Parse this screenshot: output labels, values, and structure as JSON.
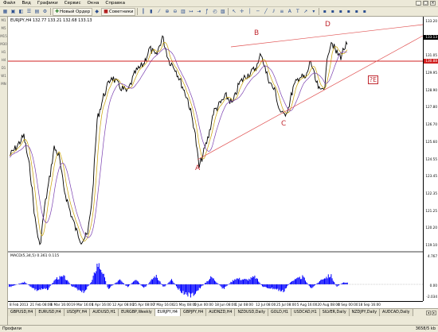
{
  "menu": [
    "Файл",
    "Вид",
    "Графики",
    "Сервис",
    "Окна",
    "Справка"
  ],
  "toolbar": {
    "new_order": "Новый Ордер",
    "advisors": "Советники"
  },
  "sidebar_items": [
    "M1",
    "M5",
    "M15",
    "M30",
    "H1",
    "H4",
    "D1",
    "W1",
    "MN"
  ],
  "chart": {
    "title": "EURJPY,H4  132.77 133.21 132.68 133.13",
    "price_labels": [
      "133.20",
      "132.10",
      "131.05",
      "129.95",
      "128.90",
      "127.80",
      "126.70",
      "125.60",
      "124.55",
      "123.45",
      "122.35",
      "121.25",
      "120.20",
      "119.10"
    ],
    "current_price": "133.13",
    "line_price": "130.88",
    "macd_title": "MACD(5,34,5) 0.361 0.115",
    "macd_labels": [
      "4.767",
      "0.00",
      "-2.034"
    ],
    "time_labels": [
      "8 Feb 2013",
      "21 Feb 08:00",
      "6 Mar 16:00",
      "19 Mar 16:00",
      "1 Apr 16:00",
      "12 Apr 08:00",
      "25 Apr 08:00",
      "7 May 16:00",
      "21 May 08:00",
      "5 Jun 00:00",
      "18 Jun 08:00",
      "1 Jul 08:00",
      "12 Jul 08:00",
      "25 Jul 08:00",
      "5 Aug 16:00",
      "20 Aug 08:00",
      "4 Sep 00:00",
      "18 Sep 16:00"
    ],
    "wave_labels": {
      "a": "A",
      "b": "B",
      "c": "C",
      "d": "D"
    },
    "tq_box": "?E",
    "colors": {
      "price": "#000000",
      "ma_fast": "#c8a000",
      "ma_slow": "#7a3fb0",
      "trendline": "#e05050",
      "hline": "#d02020",
      "macd": "#0000ff"
    }
  },
  "tabs": [
    "GBPUSD,H4",
    "EURUSD,H4",
    "USDJPY,H4",
    "AUDUSD,H1",
    "EURGBP,Weekly",
    "EURJPY,H4",
    "GBPJPY,H4",
    "AUDNZD,H4",
    "NZDUSD,Daily",
    "GOLD,H1",
    "USDCAD,H1",
    "SILVER,Daily",
    "NZDJPY,Daily",
    "AUDCAD,Daily"
  ],
  "active_tab": "EURJPY,H4",
  "status": {
    "left": "Профили",
    "right": "3658/5 kb"
  }
}
